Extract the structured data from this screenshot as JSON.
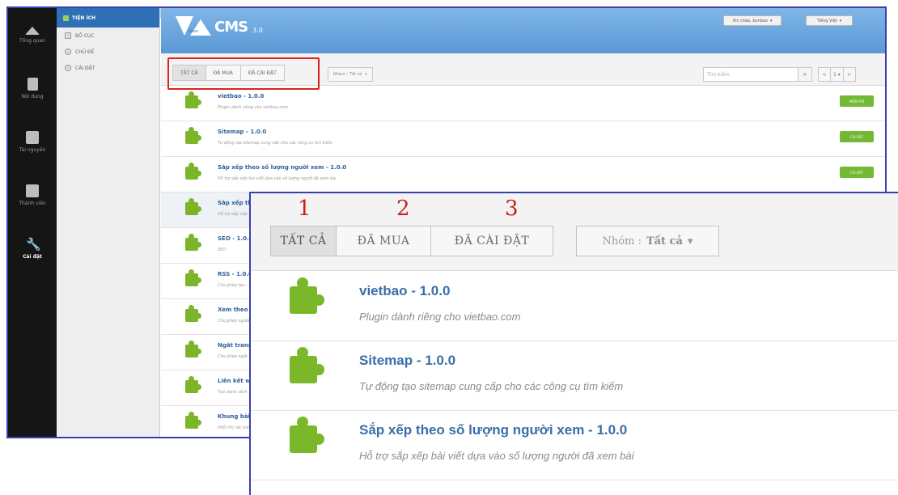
{
  "rail": [
    {
      "label": "Tổng quan",
      "icon": "home-icon"
    },
    {
      "label": "Nội dung",
      "icon": "document-icon"
    },
    {
      "label": "Tài nguyên",
      "icon": "folder-icon"
    },
    {
      "label": "Thành viên",
      "icon": "users-icon"
    },
    {
      "label": "Cài đặt",
      "icon": "wrench-icon"
    }
  ],
  "subnav": {
    "header": "TIỆN ÍCH",
    "items": [
      "BỐ CỤC",
      "CHỦ ĐỀ",
      "CÀI ĐẶT"
    ]
  },
  "collapse_label": "<<",
  "logo": {
    "brand": "vnvn",
    "text": "CMS",
    "version": "3.0"
  },
  "top": {
    "greeting": "Xin chào, bvnbao",
    "language": "Tiếng Việt"
  },
  "toolbar": {
    "tabs": [
      "TẤT CẢ",
      "ĐÃ MUA",
      "ĐÃ CÀI ĐẶT"
    ],
    "group_label": "Nhóm : Tất cả",
    "search_placeholder": "Tìm kiếm",
    "pager": [
      "<",
      "1 ▾",
      ">"
    ]
  },
  "plugins": [
    {
      "name": "vietbao - 1.0.0",
      "desc": "Plugin dành riêng cho vietbao.com",
      "action": "MIỄN PHÍ"
    },
    {
      "name": "Sitemap - 1.0.0",
      "desc": "Tự động tạo sitemap cung cấp cho các công cụ tìm kiếm",
      "action": "CÀI ĐẶT"
    },
    {
      "name": "Sắp xếp theo số lượng người xem - 1.0.0",
      "desc": "Hỗ trợ sắp xếp bài viết dựa vào số lượng người đã xem bài",
      "action": "CÀI ĐẶT"
    },
    {
      "name": "Sắp xếp theo ...",
      "desc": "Hỗ trợ sắp xếp ...",
      "action": ""
    },
    {
      "name": "SEO - 1.0.0",
      "desc": "SEO",
      "action": ""
    },
    {
      "name": "RSS - 1.0.0",
      "desc": "Cho phép tạo ...",
      "action": ""
    },
    {
      "name": "Xem theo ...",
      "desc": "Cho phép người ...",
      "action": ""
    },
    {
      "name": "Ngắt trang ...",
      "desc": "Cho phép ngắt ...",
      "action": ""
    },
    {
      "name": "Liên kết w...",
      "desc": "Tạo danh sách ...",
      "action": ""
    },
    {
      "name": "Khung bài ...",
      "desc": "Hiển thị các bài ...",
      "action": ""
    }
  ],
  "zoom": {
    "numbers": [
      "1",
      "2",
      "3"
    ],
    "tabs": [
      "TẤT CẢ",
      "ĐÃ MUA",
      "ĐÃ CÀI ĐẶT"
    ],
    "group_prefix": "Nhóm :",
    "group_value": "Tất cả",
    "plugins": [
      {
        "name": "vietbao - 1.0.0",
        "desc": "Plugin dành riêng cho vietbao.com"
      },
      {
        "name": "Sitemap - 1.0.0",
        "desc": "Tự động tạo sitemap cung cấp cho các công cụ tìm kiếm"
      },
      {
        "name": "Sắp xếp theo số lượng người xem - 1.0.0",
        "desc": "Hỗ trợ sắp xếp bài viết dựa vào số lượng người đã xem bài"
      }
    ]
  },
  "colors": {
    "accent": "#5a98d6",
    "highlight_box": "#e02020",
    "frame": "#3a3fb0",
    "install": "#74b936"
  }
}
